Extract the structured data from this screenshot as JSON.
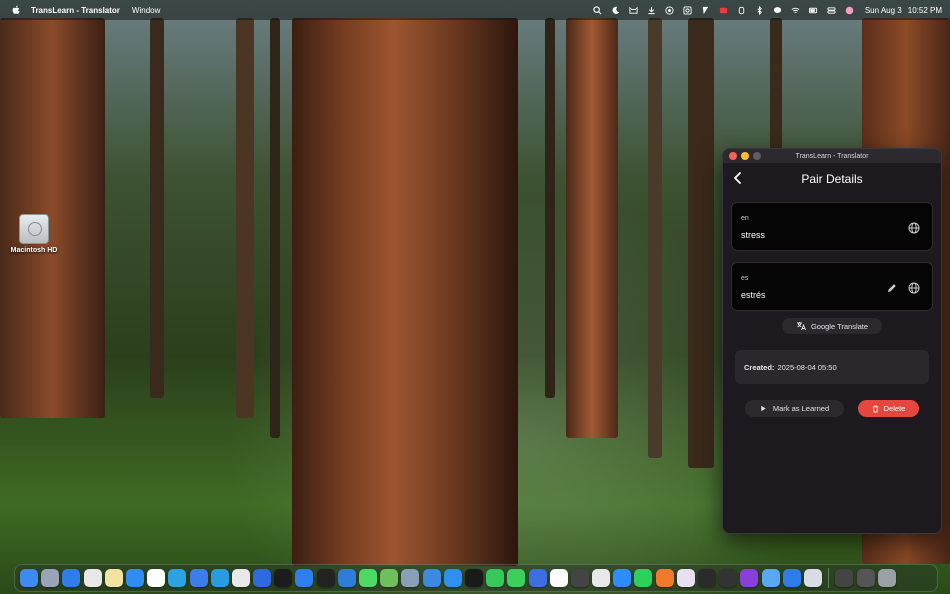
{
  "menubar": {
    "app_name": "TransLearn - Translator",
    "menus": [
      "Window"
    ],
    "date": "Sun Aug 3",
    "time": "10:52 PM",
    "status_icons": [
      "search-icon",
      "moon-icon",
      "cat-icon",
      "download-icon",
      "record-icon",
      "screenshot-icon",
      "display-icon",
      "battery-app-icon",
      "timer-icon",
      "bluetooth-icon",
      "chat-icon",
      "wifi-icon",
      "battery-icon",
      "control-center-icon",
      "avatar-icon"
    ]
  },
  "desktop": {
    "disk_label": "Macintosh HD"
  },
  "window": {
    "title": "TransLearn - Translator",
    "page_title": "Pair Details",
    "source": {
      "lang": "en",
      "word": "stress"
    },
    "target": {
      "lang": "es",
      "word": "estrés"
    },
    "translate_button": "Google Translate",
    "created_label": "Created:",
    "created_value": "2025-08-04 05:50",
    "mark_learned_button": "Mark as Learned",
    "delete_button": "Delete"
  },
  "colors": {
    "window_bg": "#1c1a1f",
    "card_bg": "#050505",
    "delete_red": "#e5473f"
  },
  "dock": {
    "apps": [
      {
        "icon": "finder-icon",
        "color": "#3d8bf0"
      },
      {
        "icon": "launchpad-icon",
        "color": "#9aa4b8"
      },
      {
        "icon": "safari-icon",
        "color": "#2f7de8"
      },
      {
        "icon": "chrome-icon",
        "color": "#e8e8e8"
      },
      {
        "icon": "notes-icon",
        "color": "#f3e2a0"
      },
      {
        "icon": "appstore-icon",
        "color": "#2f8cf0"
      },
      {
        "icon": "calendar-icon",
        "color": "#ffffff"
      },
      {
        "icon": "telegram-icon",
        "color": "#2aa3e0"
      },
      {
        "icon": "xcode-icon",
        "color": "#3c7de8"
      },
      {
        "icon": "telegram-alt-icon",
        "color": "#2a9de0"
      },
      {
        "icon": "chatgpt-icon",
        "color": "#e8e8e8"
      },
      {
        "icon": "trello-icon",
        "color": "#2d6ae0"
      },
      {
        "icon": "pycharm-icon",
        "color": "#1c1c1c"
      },
      {
        "icon": "maps-icon",
        "color": "#2f7ef0"
      },
      {
        "icon": "cube-icon",
        "color": "#222222"
      },
      {
        "icon": "vscode-icon",
        "color": "#2d7fd6"
      },
      {
        "icon": "messages-icon",
        "color": "#4cd964"
      },
      {
        "icon": "maps-alt-icon",
        "color": "#6fbf5a"
      },
      {
        "icon": "screen-icon",
        "color": "#8aa0b8"
      },
      {
        "icon": "preview-icon",
        "color": "#3c8ae0"
      },
      {
        "icon": "appstore-alt-icon",
        "color": "#3090f0"
      },
      {
        "icon": "terminal-icon",
        "color": "#1a1a1a"
      },
      {
        "icon": "numbers-icon",
        "color": "#36c85a"
      },
      {
        "icon": "facetime-icon",
        "color": "#3ccf5c"
      },
      {
        "icon": "xcode-alt-icon",
        "color": "#3c6fe0"
      },
      {
        "icon": "yandex-icon",
        "color": "#ffffff"
      },
      {
        "icon": "calculator-icon",
        "color": "#444444"
      },
      {
        "icon": "textedit-icon",
        "color": "#e8e8e8"
      },
      {
        "icon": "zoom-icon",
        "color": "#2d8cff"
      },
      {
        "icon": "whatsapp-icon",
        "color": "#2dd05a"
      },
      {
        "icon": "firefox-icon",
        "color": "#f07a2a"
      },
      {
        "icon": "slack-icon",
        "color": "#e8e0f0"
      },
      {
        "icon": "grapher-icon",
        "color": "#2a2a2a"
      },
      {
        "icon": "activity-monitor-icon",
        "color": "#333333"
      },
      {
        "icon": "arc-icon",
        "color": "#8a3fd8"
      },
      {
        "icon": "finder-alt-icon",
        "color": "#5aa8f0"
      },
      {
        "icon": "simulator-icon",
        "color": "#2f7de8"
      },
      {
        "icon": "instruments-icon",
        "color": "#d8dde4"
      },
      {
        "icon": "window-icon",
        "color": "#444444"
      },
      {
        "icon": "screen-sharing-icon",
        "color": "#555555"
      },
      {
        "icon": "trash-icon",
        "color": "#9aa0a6"
      }
    ]
  }
}
